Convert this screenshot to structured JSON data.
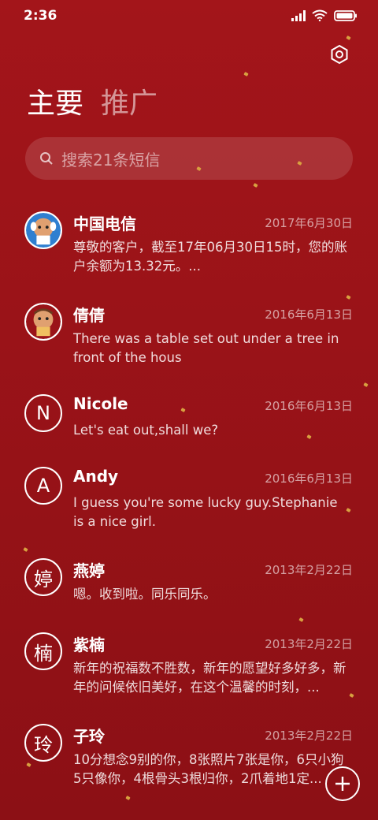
{
  "status_bar": {
    "time": "2:36"
  },
  "tabs": [
    {
      "label": "主要",
      "active": true
    },
    {
      "label": "推广",
      "active": false
    }
  ],
  "search": {
    "placeholder": "搜索21条短信"
  },
  "conversations": [
    {
      "name": "中国电信",
      "date": "2017年6月30日",
      "preview": "尊敬的客户，截至17年06月30日15时，您的账户余额为13.32元。...",
      "avatar_letter": ""
    },
    {
      "name": "倩倩",
      "date": "2016年6月13日",
      "preview": "There was a table set out under a tree in front of the hous",
      "avatar_letter": ""
    },
    {
      "name": "Nicole",
      "date": "2016年6月13日",
      "preview": "Let's eat out,shall we?",
      "avatar_letter": "N"
    },
    {
      "name": "Andy",
      "date": "2016年6月13日",
      "preview": "I guess you're some lucky guy.Stephanie is a nice girl.",
      "avatar_letter": "A"
    },
    {
      "name": "燕婷",
      "date": "2013年2月22日",
      "preview": "嗯。收到啦。同乐同乐。",
      "avatar_letter": "婷"
    },
    {
      "name": "紫楠",
      "date": "2013年2月22日",
      "preview": "新年的祝福数不胜数，新年的愿望好多好多，新年的问候依旧美好，在这个温馨的时刻，...",
      "avatar_letter": "楠"
    },
    {
      "name": "子玲",
      "date": "2013年2月22日",
      "preview": "10分想念9别的你，8张照片7张是你，6只小狗5只像你，4根骨头3根归你，2爪着地1定...",
      "avatar_letter": "玲"
    }
  ],
  "colors": {
    "background": "#9a1318",
    "accent": "#ffffff",
    "gold_fleck": "#d8a040"
  },
  "icons": {
    "settings": "settings-icon",
    "search": "search-icon",
    "compose": "compose-plus-icon"
  }
}
